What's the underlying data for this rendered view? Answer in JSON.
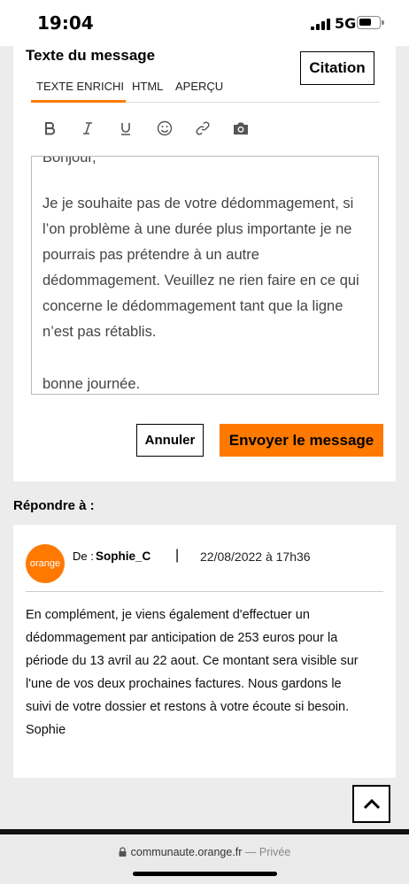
{
  "status_bar": {
    "time": "19:04",
    "network": "5G"
  },
  "editor": {
    "title": "Texte du message",
    "citation_label": "Citation",
    "tabs": [
      {
        "label": "TEXTE ENRICHI",
        "active": true
      },
      {
        "label": "HTML",
        "active": false
      },
      {
        "label": "APERÇU",
        "active": false
      }
    ],
    "toolbar": [
      "bold-icon",
      "italic-icon",
      "underline-icon",
      "emoji-icon",
      "link-icon",
      "camera-icon"
    ],
    "body_lines": [
      "Bonjour,",
      "",
      "Je je souhaite pas de votre dédommagement, si",
      "l’on problème à une durée plus importante je ne",
      "pourrais pas prétendre à un autre",
      "dédommagement. Veuillez ne rien faire en ce qui",
      "concerne le dédommagement tant que la ligne",
      "n’est pas rétablis.",
      "",
      "bonne journée."
    ],
    "cancel_label": "Annuler",
    "send_label": "Envoyer le message"
  },
  "reply": {
    "heading": "Répondre à :",
    "avatar_text": "orange",
    "author_prefix": "De :",
    "author": "Sophie_C",
    "separator": "|",
    "date": "22/08/2022 à 17h36",
    "message_lines": [
      "En complément, je viens également d'effectuer un",
      "dédommagement par anticipation de 253 euros pour la",
      "période du 13 avril au 22 aout. Ce montant sera visible sur",
      "l'une de vos deux prochaines factures. Nous gardons le",
      "suivi de votre dossier et restons à votre écoute si besoin.",
      "Sophie"
    ]
  },
  "browser": {
    "url": "communaute.orange.fr",
    "mode": "— Privée"
  },
  "colors": {
    "accent": "#ff7900"
  }
}
